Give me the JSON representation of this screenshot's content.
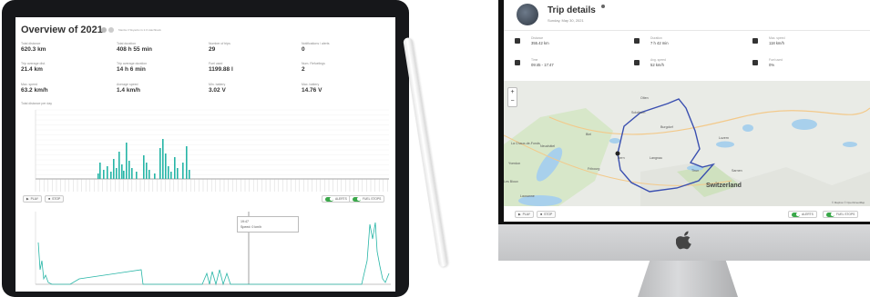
{
  "overview": {
    "title": "Overview of 2021",
    "subtitle": "Mazda 3 Skyactiv-G 2.0 Hatchback",
    "stats": [
      {
        "label": "Total distance",
        "value": "620.3 km"
      },
      {
        "label": "Total duration",
        "value": "408 h 55 min"
      },
      {
        "label": "Number of trips",
        "value": "29"
      },
      {
        "label": "Notifications / alerts",
        "value": "0"
      },
      {
        "label": "Trip average dist.",
        "value": "21.4 km"
      },
      {
        "label": "Trip average duration",
        "value": "14 h 6 min"
      },
      {
        "label": "Fuel used",
        "value": "1199.88 l"
      },
      {
        "label": "Num. Refuelings",
        "value": "2"
      },
      {
        "label": "Max. speed",
        "value": "63.2 km/h"
      },
      {
        "label": "Average speed",
        "value": "1.4 km/h"
      },
      {
        "label": "Min. battery",
        "value": "3.02 V"
      },
      {
        "label": "Max. battery",
        "value": "14.76 V"
      }
    ],
    "chart_label": "Total distance per day",
    "controls": {
      "play": "PLAY",
      "stop": "STOP",
      "alerts": "ALERTS",
      "fuel_stops": "FUEL STOPS"
    },
    "tooltip": {
      "time": "19:47",
      "speed": "Speed: 0 km/h"
    }
  },
  "trip": {
    "title": "Trip details",
    "date": "Sunday, May 30, 2021",
    "stats": [
      {
        "label": "Distance",
        "value": "355.42 km",
        "icon": "road-icon"
      },
      {
        "label": "Duration",
        "value": "7 h 42 min",
        "icon": "clock-icon"
      },
      {
        "label": "Max. speed",
        "value": "118 km/h",
        "icon": "speedometer-icon"
      },
      {
        "label": "Time",
        "value": "09:45 - 17:47",
        "icon": "time-icon"
      },
      {
        "label": "Avg. speed",
        "value": "52 km/h",
        "icon": "gauge-icon"
      },
      {
        "label": "Fuel used",
        "value": "0%",
        "icon": "fuel-icon"
      }
    ],
    "map": {
      "zoom_in": "+",
      "zoom_out": "−",
      "country": "Switzerland",
      "places": [
        "La Chaux-de-Fonds",
        "Neuchâtel",
        "Biel",
        "Bern",
        "Fribourg",
        "Lausanne",
        "Luzern",
        "Langnau",
        "Thun",
        "Sarnen",
        "Solothurn",
        "Burgdorf",
        "Olten",
        "Les Bioux",
        "Yverdon"
      ],
      "attribution": "© Mapbox © OpenStreetMap"
    },
    "controls": {
      "play": "PLAY",
      "stop": "STOP",
      "alerts": "ALERTS",
      "fuel_stops": "FUEL STOPS"
    }
  },
  "colors": {
    "accent": "#26b5a6",
    "route": "#3a4fb0",
    "toggle": "#3aa84a"
  }
}
